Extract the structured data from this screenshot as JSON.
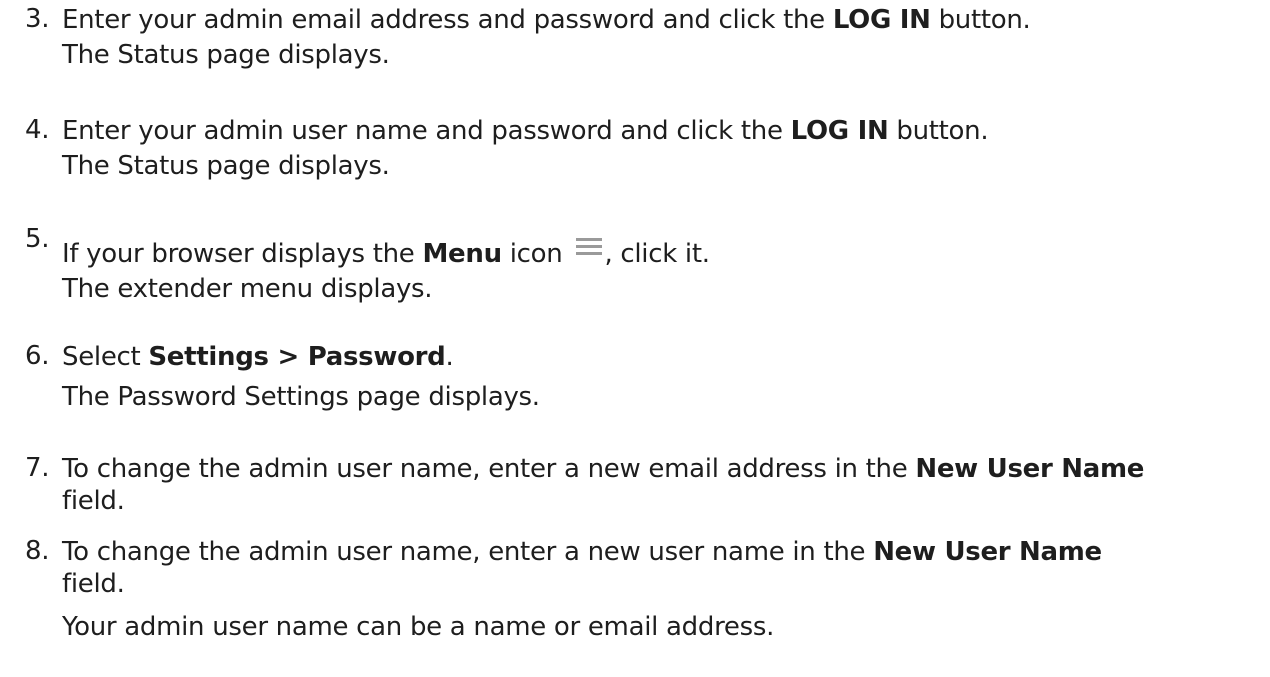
{
  "steps": [
    {
      "num": "3.",
      "line1_pre": "Enter your admin email address and password and click the ",
      "line1_bold": "LOG IN",
      "line1_post": " button.",
      "line2": "The Status page displays."
    },
    {
      "num": "4.",
      "line1_pre": "Enter your admin user name and password and click the ",
      "line1_bold": "LOG IN",
      "line1_post": " button.",
      "line2": "The Status page displays."
    },
    {
      "num": "5.",
      "line1_pre": "If your browser displays the ",
      "line1_bold": "Menu",
      "line1_mid": " icon ",
      "icon": "hamburger-menu-icon",
      "line1_post": ", click it.",
      "line2": "The extender menu displays."
    },
    {
      "num": "6.",
      "line1_pre": "Select ",
      "line1_bold": "Settings > Password",
      "line1_post": ".",
      "line2": "The Password Settings page displays."
    },
    {
      "num": "7.",
      "line1_pre": "To change the admin user name, enter a new email address in the ",
      "line1_bold": "New User Name",
      "line2": "field."
    },
    {
      "num": "8.",
      "line1_pre": "To change the admin user name, enter a new user name in the ",
      "line1_bold": "New User Name",
      "line2": "field.",
      "line3": "Your admin user name can be a name or email address."
    }
  ],
  "colors": {
    "text": "#1e1e1e",
    "icon": "#9a9a9a"
  }
}
